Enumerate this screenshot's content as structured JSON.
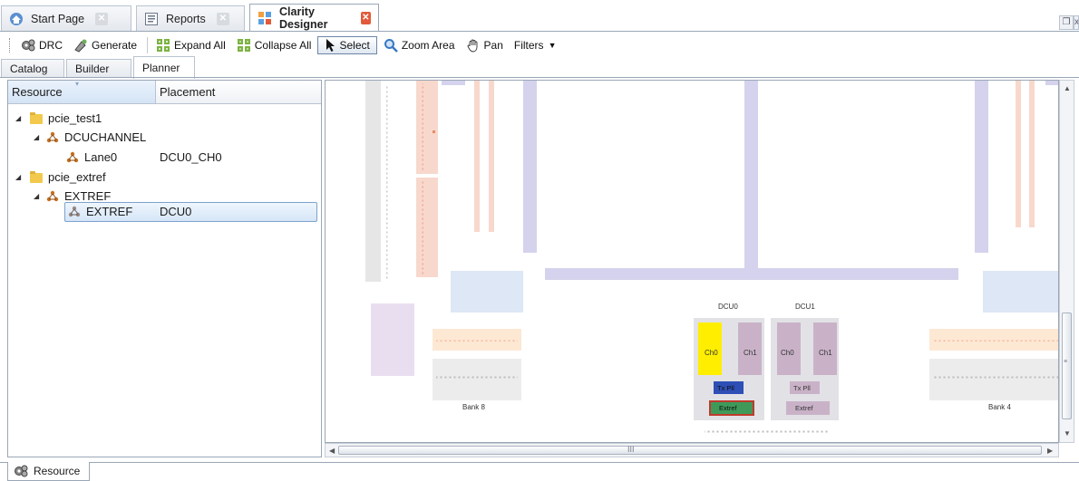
{
  "doc_tabs": [
    {
      "label": "Start Page",
      "icon": "start-page-icon",
      "active": false
    },
    {
      "label": "Reports",
      "icon": "reports-icon",
      "active": false
    },
    {
      "label": "Clarity Designer",
      "icon": "clarity-designer-icon",
      "active": true
    }
  ],
  "toolbar": {
    "drc": "DRC",
    "generate": "Generate",
    "expand_all": "Expand All",
    "collapse_all": "Collapse All",
    "select": "Select",
    "zoom_area": "Zoom Area",
    "pan": "Pan",
    "filters": "Filters"
  },
  "view_tabs": [
    {
      "label": "Catalog",
      "active": false
    },
    {
      "label": "Builder",
      "active": false
    },
    {
      "label": "Planner",
      "active": true
    }
  ],
  "tree": {
    "columns": [
      "Resource",
      "Placement"
    ],
    "rows": [
      {
        "resource": "pcie_test1",
        "placement": "",
        "kind": "folder"
      },
      {
        "resource": "DCUCHANNEL",
        "placement": "",
        "kind": "group"
      },
      {
        "resource": "Lane0",
        "placement": "DCU0_CH0",
        "kind": "leaf"
      },
      {
        "resource": "pcie_extref",
        "placement": "",
        "kind": "folder"
      },
      {
        "resource": "EXTREF",
        "placement": "",
        "kind": "group"
      },
      {
        "resource": "EXTREF",
        "placement": "DCU0",
        "kind": "leaf",
        "selected": true
      }
    ]
  },
  "planner": {
    "dcu0": "DCU0",
    "dcu1": "DCU1",
    "ch0": "Ch0",
    "ch1": "Ch1",
    "txpll": "Tx Pll",
    "extref": "Extref",
    "bank8": "Bank 8",
    "bank4": "Bank 4",
    "colors": {
      "selected_channel": "#ffee00",
      "txpll_selected": "#2e4fb5",
      "extref_selected": "#3f9a5a",
      "channel": "#c9b2c8",
      "bus": "#d4d2ec",
      "io_pink": "#f8d8cc",
      "io_orange": "#fde8d4",
      "io_grey": "#ececec",
      "blue_block": "#dde7f5",
      "violet_block": "#e9def0",
      "dcu_bg": "#e2e2e6"
    }
  },
  "scroll": {
    "h_grip": "III"
  },
  "bottom_tab": {
    "label": "Resource",
    "icon": "resource-icon"
  }
}
